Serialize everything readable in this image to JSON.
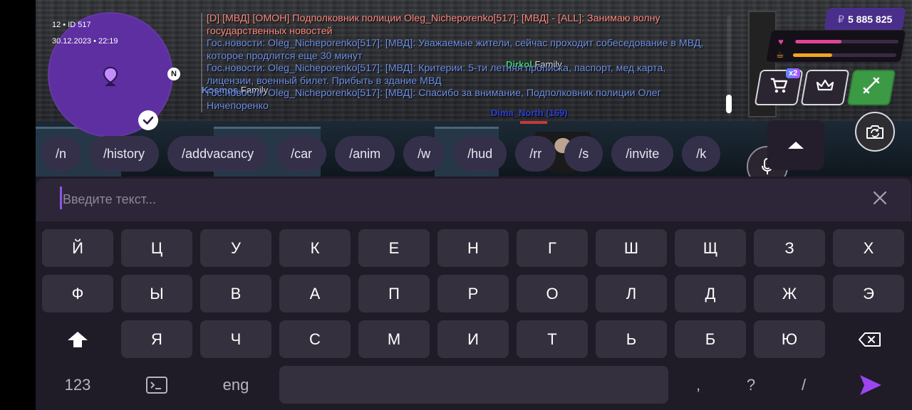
{
  "map": {
    "server_line": "12 • ID 517",
    "datetime": "30.12.2023 • 22:19",
    "compass": "N"
  },
  "chat": [
    {
      "color": "red",
      "text": "[D] [МВД] [ОМОН] Подполковник полиции Oleg_Nicheporenko[517]: [МВД] - [ALL]: Занимаю волну государственных новостей"
    },
    {
      "color": "blue",
      "text": "Гос.новости: Oleg_Nicheporenko[517]: [МВД]: Уважаемые жители, сейчас проходит собеседование в МВД, которое продлится еще 30 минут"
    },
    {
      "color": "blue",
      "text": "Гос.новости: Oleg_Nicheporenko[517]: [МВД]: Критерии: 5-ти летняя прописка, паспорт, мед карта, лицензии, военный билет. Прибыть в здание МВД"
    },
    {
      "color": "blue",
      "text": "Гос.новости: Oleg_Nicheporenko[517]: [МВД]: Спасибо за внимание, Подполковник полиции Олег Ничепоренко"
    }
  ],
  "nametags": {
    "dirkol": {
      "name": "Dirkol",
      "family": "Family"
    },
    "kosmos": {
      "name": "Kosmos",
      "family": "Family"
    },
    "dima": {
      "name": "Dima_North (169)"
    }
  },
  "hud": {
    "currency_symbol": "₽",
    "money": "5 885 825",
    "health_icon": "heart-icon",
    "health_level": 0.45,
    "hunger_icon": "food-icon",
    "hunger_level": 0.38,
    "shop_badge": "x2"
  },
  "commands": [
    "/n",
    "/history",
    "/addvacancy",
    "/car",
    "/anim",
    "/w",
    "/hud",
    "/rr",
    "/s",
    "/invite",
    "/k"
  ],
  "input": {
    "placeholder": "Введите текст...",
    "value": ""
  },
  "keyboard": {
    "row1": [
      "Й",
      "Ц",
      "У",
      "К",
      "Е",
      "Н",
      "Г",
      "Ш",
      "Щ",
      "З",
      "Х"
    ],
    "row2": [
      "Ф",
      "Ы",
      "В",
      "А",
      "П",
      "Р",
      "О",
      "Л",
      "Д",
      "Ж",
      "Э"
    ],
    "row3": [
      "Я",
      "Ч",
      "С",
      "М",
      "И",
      "Т",
      "Ь",
      "Б",
      "Ю"
    ],
    "num_label": "123",
    "lang_label": "eng",
    "punct": [
      ",",
      "?",
      "/"
    ]
  },
  "colors": {
    "accent": "#8e55e8",
    "map_purple": "#5d2fa0",
    "chat_red": "#ff8a80",
    "chat_blue": "#6f8fe6",
    "health": "#e0449a",
    "hunger": "#f1a522",
    "money_bg": "#4a2f8a",
    "gun_green": "#3c9a45"
  }
}
